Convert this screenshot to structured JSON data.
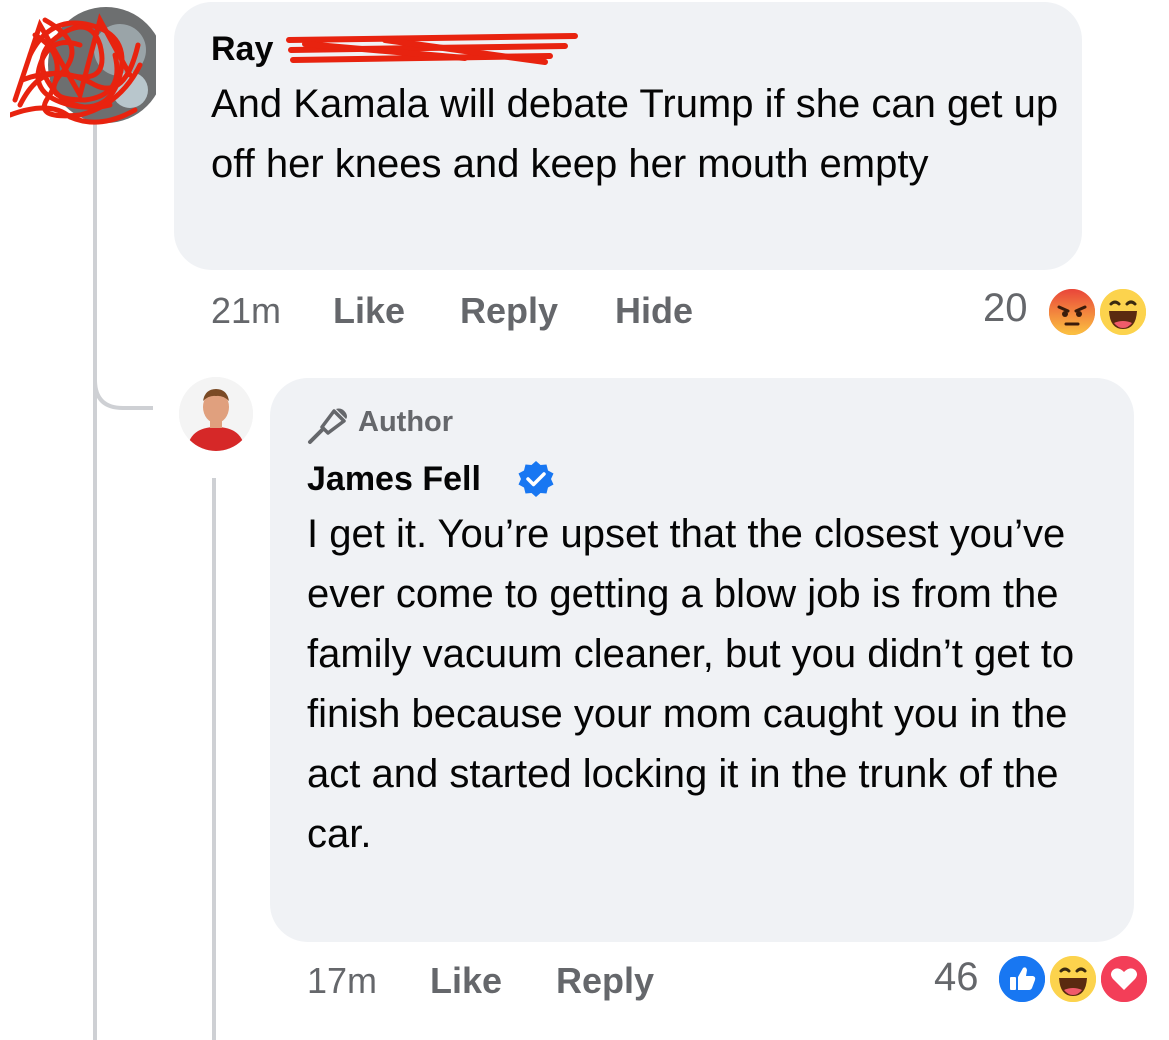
{
  "comment": {
    "author_name": "Ray",
    "text": "And Kamala will debate Trump if she can get up off her knees and keep her mouth empty",
    "time": "21m",
    "like_label": "Like",
    "reply_label": "Reply",
    "hide_label": "Hide",
    "reaction_count": "20",
    "reactions": [
      "angry-icon",
      "haha-icon"
    ]
  },
  "reply": {
    "badge_label": "Author",
    "author_name": "James Fell",
    "verified": true,
    "text": "I get it. You’re upset that the closest you’ve ever come to getting a blow job is from the family vacuum cleaner, but you didn’t get to finish because your mom caught you in the act and started locking it in the trunk of the car.",
    "time": "17m",
    "like_label": "Like",
    "reply_label": "Reply",
    "reaction_count": "46",
    "reactions": [
      "like-icon",
      "haha-icon",
      "love-icon"
    ]
  },
  "colors": {
    "bubble": "#f0f2f5",
    "secondary_text": "#65676b",
    "verified_blue": "#1877f2",
    "redaction_red": "#e8230f",
    "like_blue": "#1877f2",
    "love_red": "#f33e58",
    "emoji_yellow": "#fcd34d",
    "angry_orange": "#f26b2f"
  }
}
